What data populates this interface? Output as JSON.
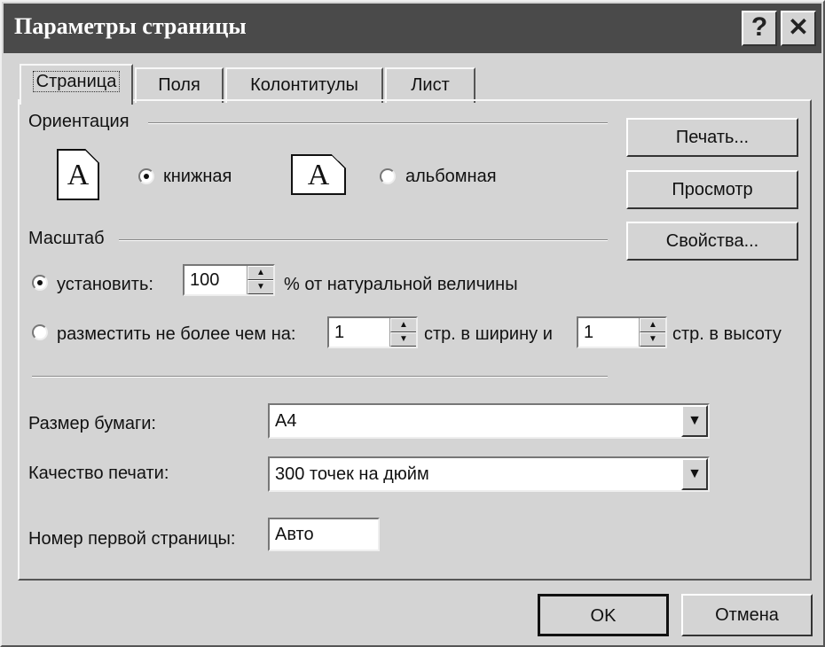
{
  "window": {
    "title": "Параметры страницы",
    "help_glyph": "?",
    "close_glyph": "✕"
  },
  "tabs": [
    {
      "label": "Страница",
      "active": true
    },
    {
      "label": "Поля",
      "active": false
    },
    {
      "label": "Колонтитулы",
      "active": false
    },
    {
      "label": "Лист",
      "active": false
    }
  ],
  "orientation": {
    "group_label": "Ориентация",
    "portrait_icon_letter": "A",
    "portrait_label": "книжная",
    "portrait_selected": true,
    "landscape_icon_letter": "A",
    "landscape_label": "альбомная",
    "landscape_selected": false
  },
  "scale": {
    "group_label": "Масштаб",
    "set_label": "установить:",
    "set_selected": true,
    "set_value": "100",
    "set_suffix": "% от натуральной величины",
    "fit_label": "разместить не более чем на:",
    "fit_selected": false,
    "fit_width_value": "1",
    "fit_width_suffix": "стр. в ширину и",
    "fit_height_value": "1",
    "fit_height_suffix": "стр. в высоту"
  },
  "paper": {
    "size_label": "Размер бумаги:",
    "size_value": "A4",
    "quality_label": "Качество печати:",
    "quality_value": "300 точек на дюйм",
    "first_page_label": "Номер первой страницы:",
    "first_page_value": "Авто"
  },
  "side_buttons": {
    "print": "Печать...",
    "preview": "Просмотр",
    "properties": "Свойства..."
  },
  "footer": {
    "ok": "OK",
    "cancel": "Отмена"
  },
  "icons": {
    "spin_up": "▲",
    "spin_down": "▼",
    "dropdown": "▼"
  }
}
